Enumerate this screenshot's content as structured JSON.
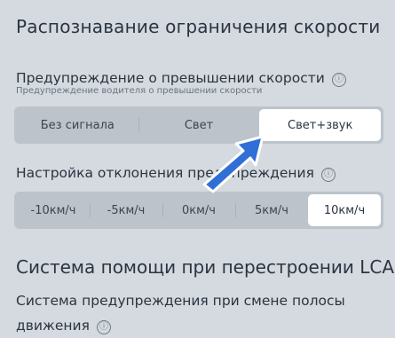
{
  "speed_limit_section": {
    "title": "Распознавание ограничения скорости"
  },
  "speed_warning": {
    "label": "Предупреждение о превышении скорости",
    "sublabel": "Предупреждение водителя о превышении скорости",
    "info_icon": "ⓘ",
    "options": [
      "Без сигнала",
      "Свет",
      "Свет+звук"
    ],
    "selected": "Свет+звук"
  },
  "deviation": {
    "label": "Настройка отклонения предупреждения",
    "info_icon": "ⓘ",
    "options": [
      "-10км/ч",
      "-5км/ч",
      "0км/ч",
      "5км/ч",
      "10км/ч"
    ],
    "selected": "10км/ч"
  },
  "lca_section": {
    "title": "Система помощи при перестроении LCA",
    "warning_label": "Система предупреждения при смене полосы движения",
    "info_icon": "ⓘ"
  },
  "colors": {
    "background": "#d4dadf",
    "segment_bg": "#bcc3ca",
    "selected_bg": "#ffffff",
    "pointer_arrow": "#2f6fd6"
  },
  "icons": {
    "info": "info-circle-icon",
    "pointer": "pointer-arrow-icon"
  }
}
